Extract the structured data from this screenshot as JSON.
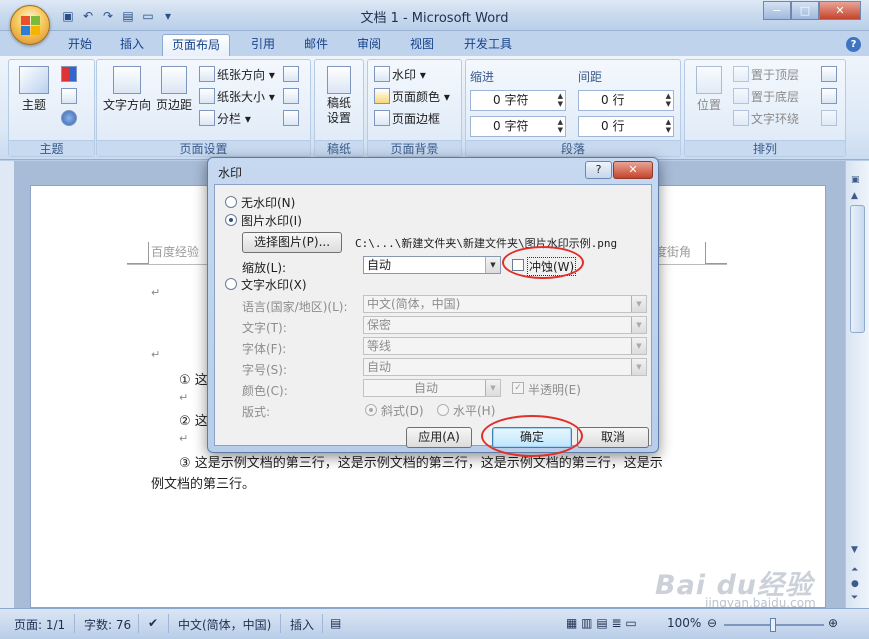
{
  "window": {
    "title": "文档 1 - Microsoft Word",
    "min": "−",
    "max": "□",
    "close": "✕"
  },
  "qat": {
    "save": "▣",
    "undo": "↶",
    "redo": "↷",
    "preview": "▤",
    "open": "▭",
    "more": "▾"
  },
  "tabs": [
    "开始",
    "插入",
    "页面布局",
    "引用",
    "邮件",
    "审阅",
    "视图",
    "开发工具"
  ],
  "help": "?",
  "ribbon": {
    "theme": {
      "label": "主题",
      "button": "主题"
    },
    "page_setup": {
      "label": "页面设置",
      "text_direction": "文字方向",
      "margins": "页边距",
      "orientation": "纸张方向",
      "size": "纸张大小",
      "columns": "分栏"
    },
    "manuscript": {
      "label": "稿纸",
      "button_line1": "稿纸",
      "button_line2": "设置"
    },
    "page_background": {
      "label": "页面背景",
      "watermark": "水印",
      "page_color": "页面颜色",
      "page_borders": "页面边框"
    },
    "paragraph": {
      "label": "段落",
      "indent": "缩进",
      "spacing": "间距",
      "indent_left": "0 字符",
      "indent_right": "0 字符",
      "spacing_before": "0 行",
      "spacing_after": "0 行"
    },
    "arrange": {
      "label": "排列",
      "position": "位置",
      "bring_front": "置于顶层",
      "send_back": "置于底层",
      "text_wrap": "文字环绕"
    }
  },
  "document": {
    "header_left": "百度经验",
    "header_right": "百度经验",
    "header_far_right": "度街角",
    "lines": [
      "① 这",
      "② 这",
      "③  这是示例文档的第三行，这是示例文档的第三行，这是示例文档的第三行，这是示",
      "例文档的第三行。"
    ]
  },
  "dialog": {
    "title": "水印",
    "no_watermark": "无水印(N)",
    "picture_watermark": "图片水印(I)",
    "select_picture": "选择图片(P)...",
    "picture_path": "C:\\...\\新建文件夹\\新建文件夹\\图片水印示例.png",
    "scale_label": "缩放(L):",
    "scale_value": "自动",
    "washout": "冲蚀(W)",
    "text_watermark": "文字水印(X)",
    "language_label": "语言(国家/地区)(L):",
    "language_value": "中文(简体，中国)",
    "text_label": "文字(T):",
    "text_value": "保密",
    "font_label": "字体(F):",
    "font_value": "等线",
    "size_label": "字号(S):",
    "size_value": "自动",
    "color_label": "颜色(C):",
    "color_value": "自动",
    "semitransparent": "半透明(E)",
    "layout_label": "版式:",
    "diagonal": "斜式(D)",
    "horizontal": "水平(H)",
    "apply": "应用(A)",
    "ok": "确定",
    "cancel": "取消"
  },
  "statusbar": {
    "page": "页面: 1/1",
    "words": "字数: 76",
    "language": "中文(简体，中国)",
    "insert": "插入",
    "zoom": "100%",
    "zoom_minus": "⊖",
    "zoom_plus": "⊕"
  },
  "watermark_brand": {
    "main": "Bai du经验",
    "sub": "jingyan.baidu.com"
  },
  "colors": {
    "accent": "#15428b",
    "red_annotation": "#e0302d",
    "ribbon": "#dce8f6"
  }
}
